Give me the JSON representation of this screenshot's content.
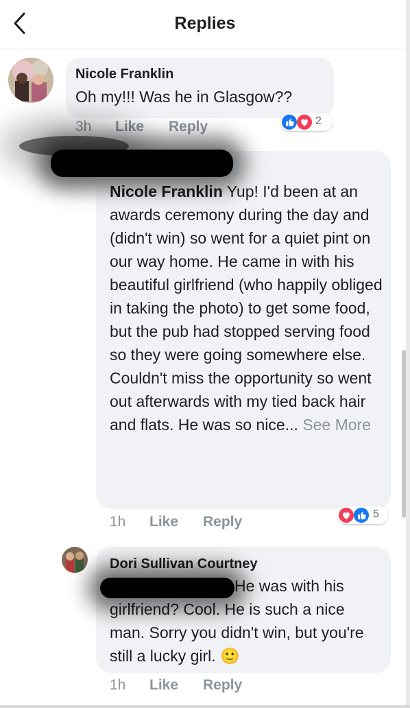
{
  "header": {
    "title": "Replies",
    "back_icon": "chevron-left-icon"
  },
  "comments": [
    {
      "author": "Nicole Franklin",
      "text": "Oh my!!! Was he in Glasgow??",
      "time": "3h",
      "like": "Like",
      "reply": "Reply",
      "reaction_count": "2",
      "reactions": [
        "like",
        "love"
      ]
    },
    {
      "author_redacted": true,
      "mention": "Nicole Franklin",
      "text": " Yup! I'd been at an awards ceremony during the day and (didn't win) so went for a quiet pint on our way home. He came in with his beautiful girlfriend (who happily obliged in taking the photo) to get some food, but the pub had stopped serving food so they were going somewhere else. Couldn't miss the opportunity so went out afterwards with my tied back hair and flats. He was so nice...",
      "see_more": "See More",
      "time": "1h",
      "like": "Like",
      "reply": "Reply",
      "reaction_count": "5",
      "reactions": [
        "love",
        "like"
      ]
    },
    {
      "author": "Dori Sullivan Courtney",
      "text_before": "",
      "text": "He was with his girlfriend?  Cool.  He is such a nice man.  Sorry you didn't win, but you're still a lucky girl. ",
      "emoji": "🙂",
      "time": "1h",
      "like": "Like",
      "reply": "Reply"
    }
  ],
  "colors": {
    "like_blue": "#1877f2",
    "love_red": "#f33e58",
    "bubble": "#f0f2f5",
    "meta": "#8d949e"
  }
}
